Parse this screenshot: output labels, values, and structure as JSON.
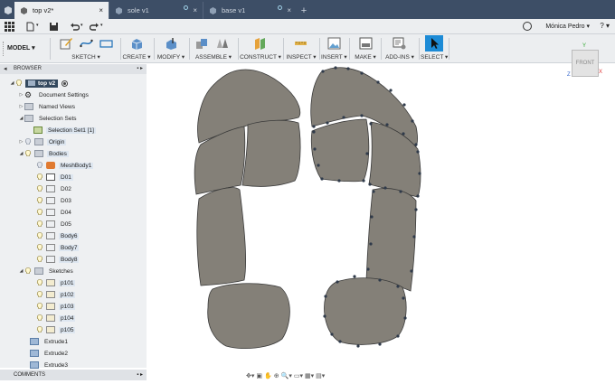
{
  "tabs": [
    {
      "label": "top v2*",
      "active": true
    },
    {
      "label": "sole v1",
      "active": false
    },
    {
      "label": "base v1",
      "active": false
    }
  ],
  "user": {
    "name": "Mónica Pedro ▾",
    "help": "? ▾"
  },
  "toolbar": {
    "workspace": "MODEL ▾",
    "groups": [
      {
        "label": "SKETCH ▾"
      },
      {
        "label": "CREATE ▾"
      },
      {
        "label": "MODIFY ▾"
      },
      {
        "label": "ASSEMBLE ▾"
      },
      {
        "label": "CONSTRUCT ▾"
      },
      {
        "label": "INSPECT ▾"
      },
      {
        "label": "INSERT ▾"
      },
      {
        "label": "MAKE ▾"
      },
      {
        "label": "ADD-INS ▾"
      },
      {
        "label": "SELECT ▾"
      }
    ]
  },
  "browser": {
    "title": "BROWSER",
    "root": "top v2",
    "items": [
      {
        "label": "Document Settings"
      },
      {
        "label": "Named Views"
      },
      {
        "label": "Selection Sets"
      },
      {
        "label": "Selection Set1 [1]"
      },
      {
        "label": "Origin"
      },
      {
        "label": "Bodies"
      },
      {
        "label": "MeshBody1"
      },
      {
        "label": "D01"
      },
      {
        "label": "D02"
      },
      {
        "label": "D03"
      },
      {
        "label": "D04"
      },
      {
        "label": "D05"
      },
      {
        "label": "Body6"
      },
      {
        "label": "Body7"
      },
      {
        "label": "Body8"
      },
      {
        "label": "Sketches"
      },
      {
        "label": "p101"
      },
      {
        "label": "p102"
      },
      {
        "label": "p103"
      },
      {
        "label": "p104"
      },
      {
        "label": "p105"
      },
      {
        "label": "Extrude1"
      },
      {
        "label": "Extrude2"
      },
      {
        "label": "Extrude3"
      }
    ]
  },
  "comments": {
    "title": "COMMENTS"
  },
  "viewcube": {
    "face": "FRONT",
    "x": "X",
    "y": "Y",
    "z": "Z"
  },
  "colors": {
    "accent": "#3d4e66",
    "shape_fill": "#848078",
    "shape_stroke": "#3a3a3a",
    "select_blue": "#1d8bd6"
  }
}
